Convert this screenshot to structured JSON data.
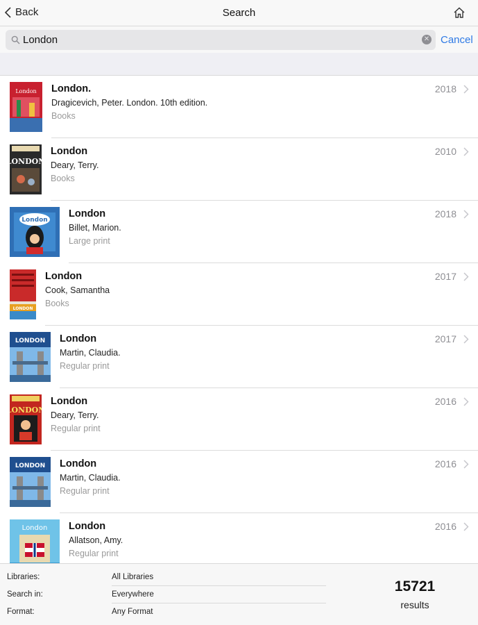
{
  "navbar": {
    "back_label": "Back",
    "title": "Search",
    "back_icon": "chevron-left-icon",
    "home_icon": "home-icon"
  },
  "search": {
    "value": "London",
    "cancel_label": "Cancel",
    "search_icon": "magnifier-icon",
    "clear_icon": "clear-icon"
  },
  "results": [
    {
      "title": "London.",
      "author": "Dragicevich, Peter. London. 10th edition.",
      "format": "Books",
      "year": "2018",
      "cover_text": "London"
    },
    {
      "title": "London",
      "author": "Deary, Terry.",
      "format": "Books",
      "year": "2010",
      "cover_text": "LONDON"
    },
    {
      "title": "London",
      "author": "Billet, Marion.",
      "format": "Large print",
      "year": "2018",
      "cover_text": "London"
    },
    {
      "title": "London",
      "author": "Cook, Samantha",
      "format": "Books",
      "year": "2017",
      "cover_text": "LONDON"
    },
    {
      "title": "London",
      "author": "Martin, Claudia.",
      "format": "Regular print",
      "year": "2017",
      "cover_text": "LONDON"
    },
    {
      "title": "London",
      "author": "Deary, Terry.",
      "format": "Regular print",
      "year": "2016",
      "cover_text": "LONDON"
    },
    {
      "title": "London",
      "author": "Martin, Claudia.",
      "format": "Regular print",
      "year": "2016",
      "cover_text": "LONDON"
    },
    {
      "title": "London",
      "author": "Allatson, Amy.",
      "format": "Regular print",
      "year": "2016",
      "cover_text": "London"
    }
  ],
  "footer": {
    "libraries_label": "Libraries:",
    "libraries_value": "All Libraries",
    "search_in_label": "Search in:",
    "search_in_value": "Everywhere",
    "format_label": "Format:",
    "format_value": "Any Format",
    "results_count": "15721",
    "results_label": "results"
  },
  "colors": {
    "accent": "#2f7ae5",
    "secondary_text": "#999999",
    "separator": "#dcdcdc"
  }
}
